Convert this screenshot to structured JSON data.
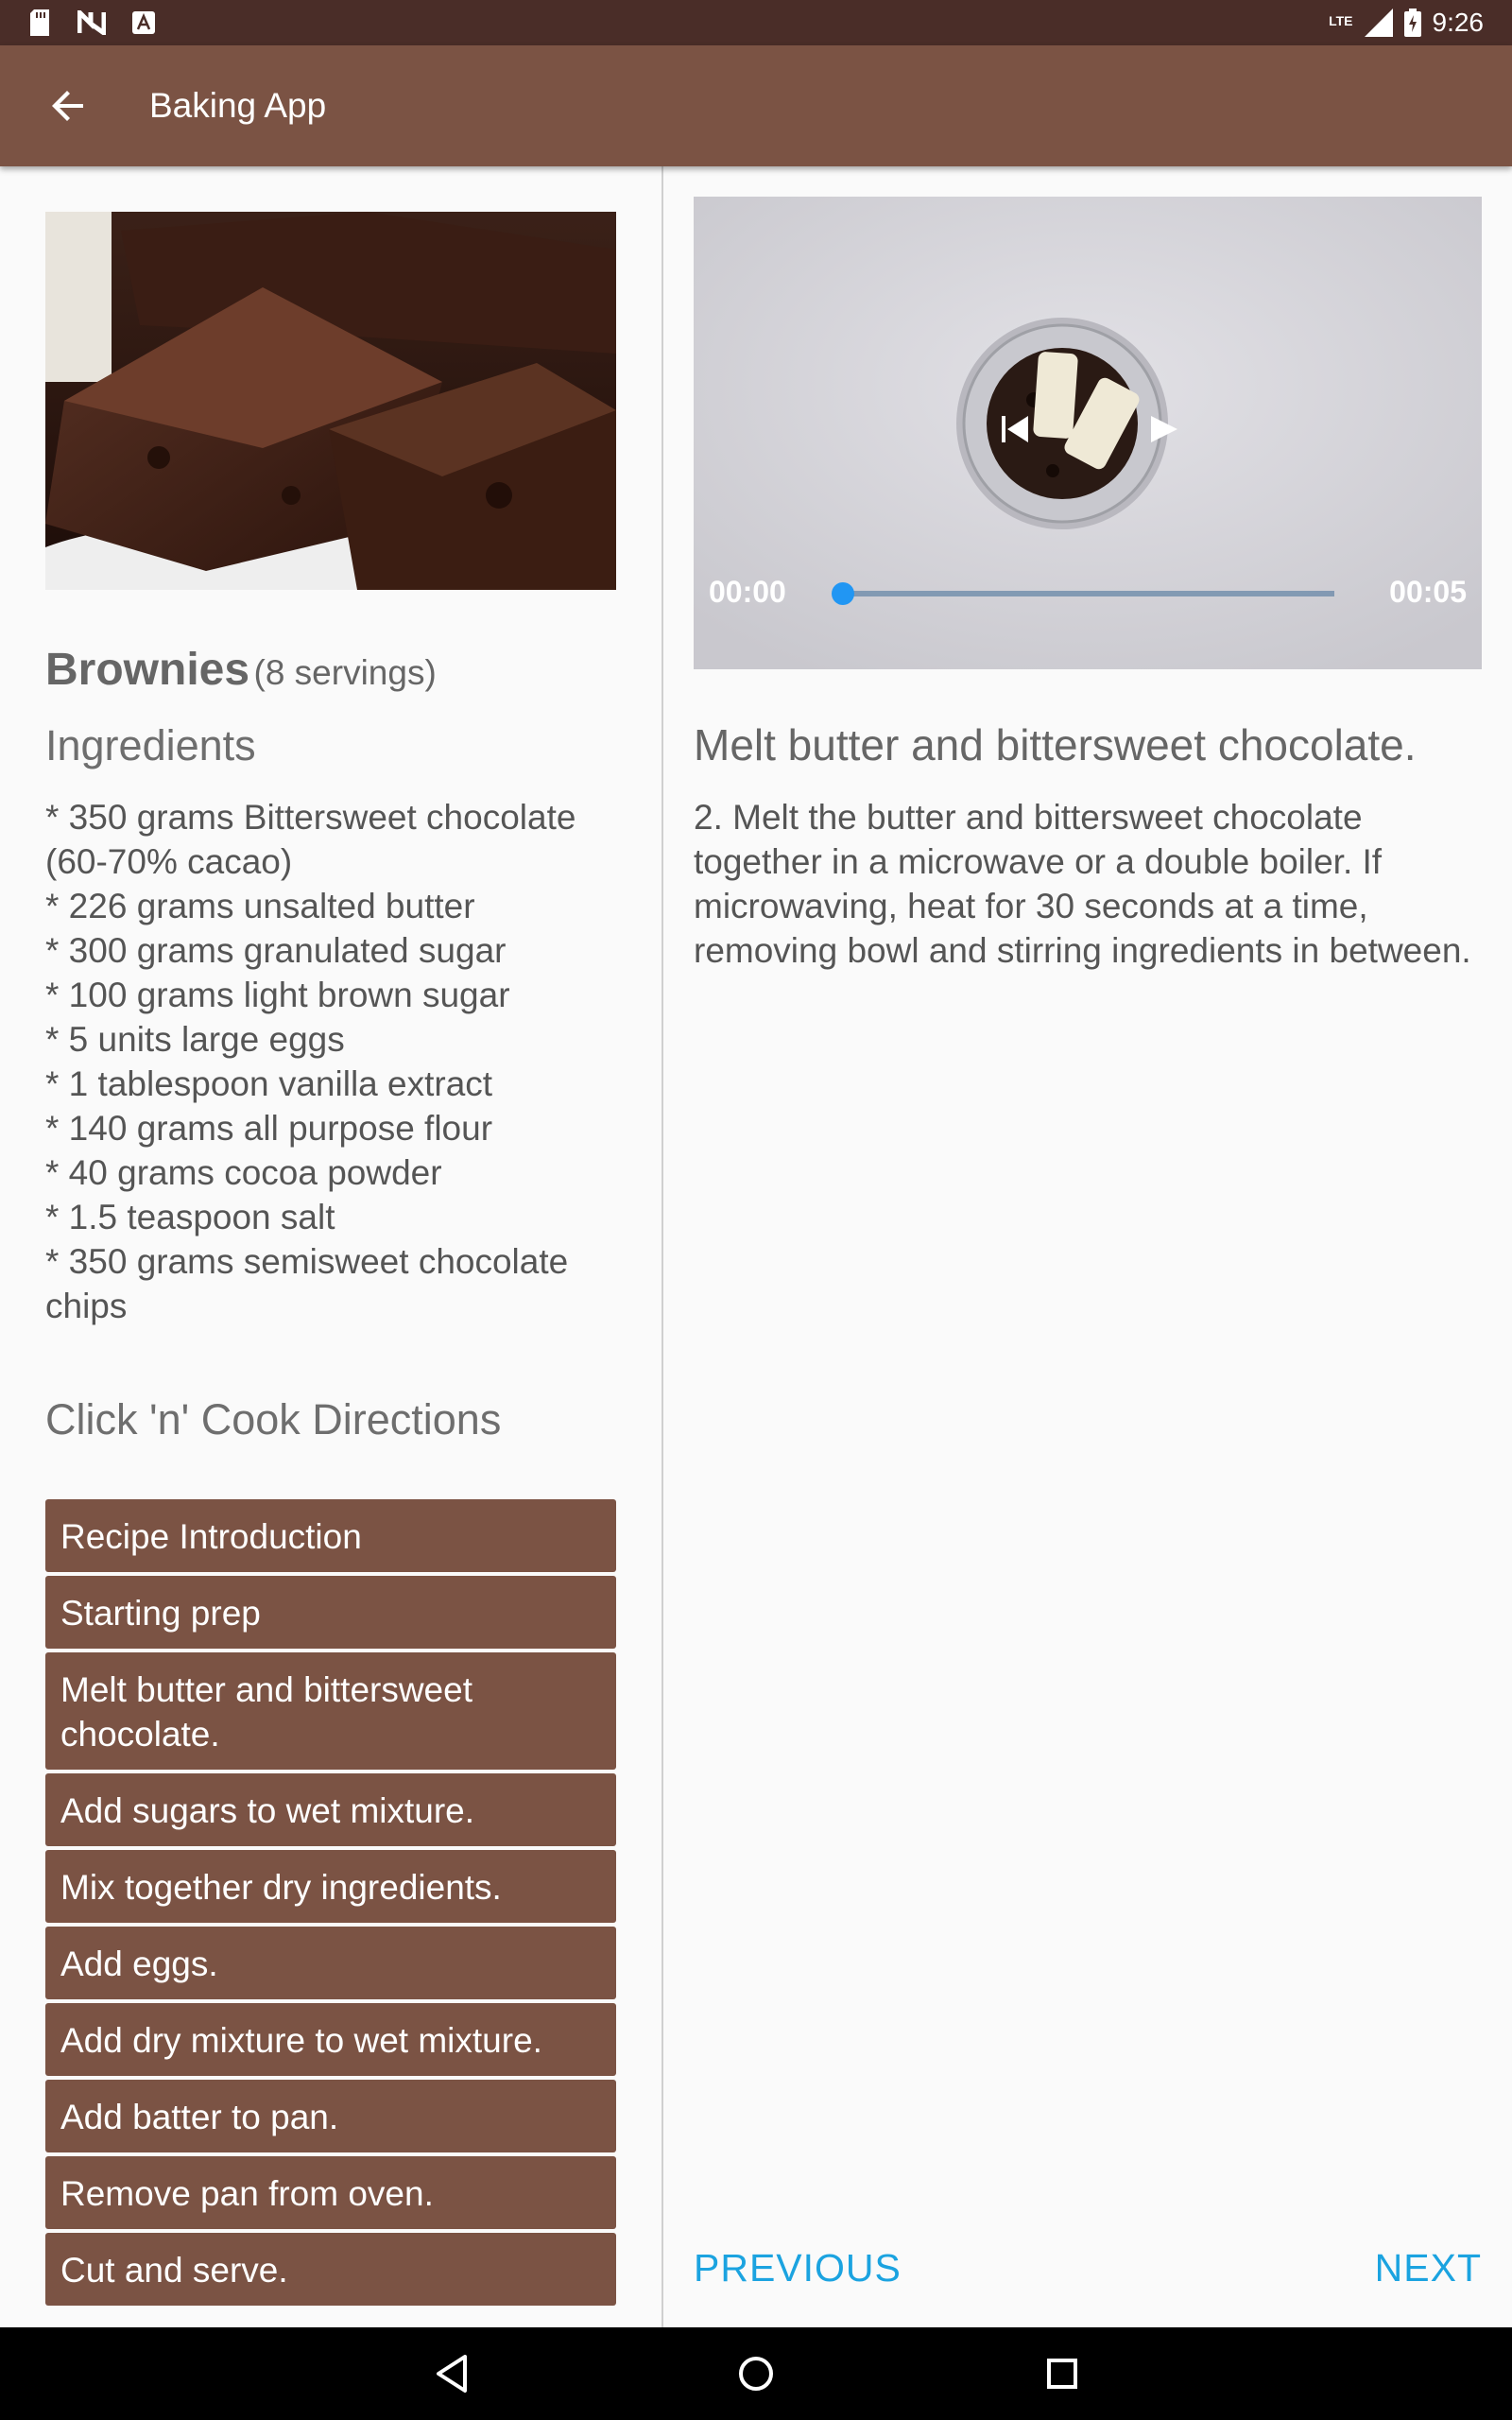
{
  "status_bar": {
    "time": "9:26",
    "network": "LTE",
    "icons": [
      "sd-card-icon",
      "n-notification-icon",
      "a-notification-icon",
      "signal-icon",
      "battery-icon"
    ]
  },
  "toolbar": {
    "title": "Baking App",
    "back_icon": "arrow-back-icon"
  },
  "recipe": {
    "name": "Brownies",
    "servings": "(8 servings)",
    "ingredients_heading": "Ingredients",
    "ingredients": [
      "* 350 grams Bittersweet chocolate (60-70% cacao)",
      "* 226 grams unsalted butter",
      "* 300 grams granulated sugar",
      "* 100 grams light brown sugar",
      "* 5 units large eggs",
      "* 1 tablespoon vanilla extract",
      "* 140 grams all purpose flour",
      "* 40 grams cocoa powder",
      "* 1.5 teaspoon salt",
      "* 350 grams semisweet chocolate chips"
    ],
    "directions_heading": "Click 'n' Cook Directions",
    "steps": [
      "Recipe Introduction",
      "Starting prep",
      "Melt butter and bittersweet chocolate.",
      "Add sugars to wet mixture.",
      "Mix together dry ingredients.",
      "Add eggs.",
      "Add dry mixture to wet mixture.",
      "Add batter to pan.",
      "Remove pan from oven.",
      "Cut and serve."
    ]
  },
  "player": {
    "current_time": "00:00",
    "total_time": "00:05",
    "progress": 0.0
  },
  "step_detail": {
    "short_description": "Melt butter and bittersweet chocolate.",
    "description": "2. Melt the butter and bittersweet chocolate together in a microwave or a double boiler. If microwaving, heat for 30 seconds at a time, removing bowl and stirring ingredients in between."
  },
  "navigation": {
    "previous_label": "PREVIOUS",
    "next_label": "NEXT"
  },
  "colors": {
    "status_bar": "#4a2d28",
    "primary": "#7b5344",
    "accent": "#1ba3e0",
    "seek_thumb": "#2196f3"
  }
}
